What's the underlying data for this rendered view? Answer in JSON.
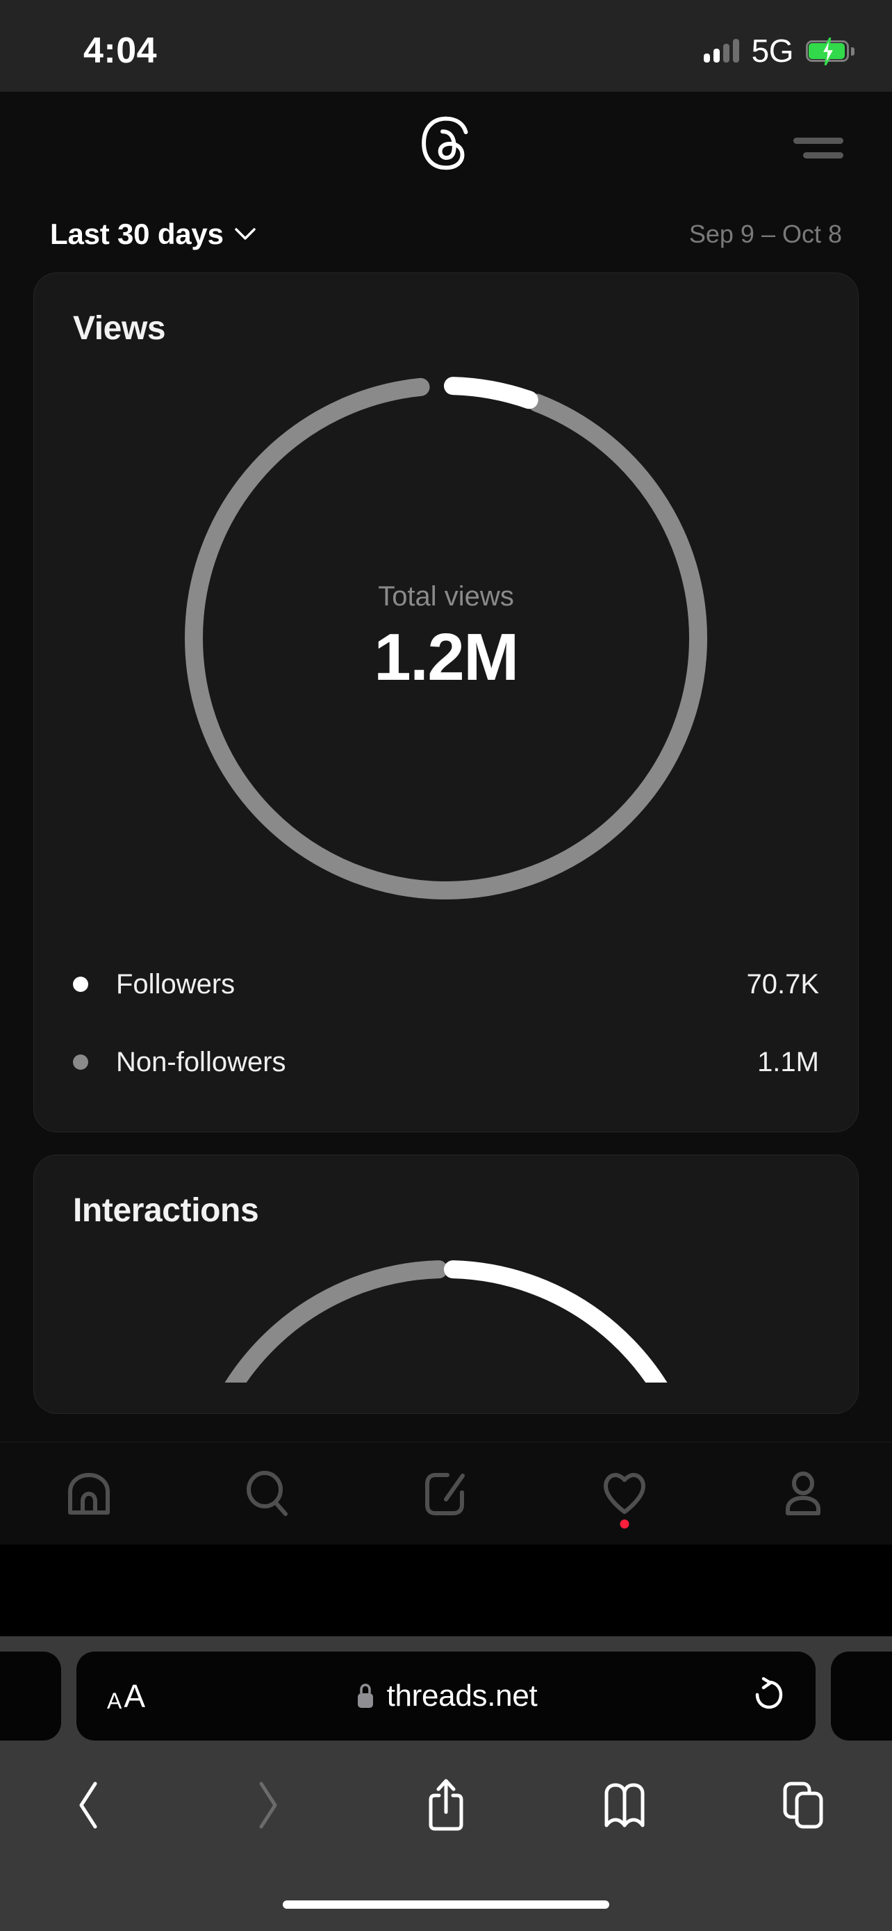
{
  "status_bar": {
    "time": "4:04",
    "network": "5G",
    "signal_icon": "signal-bars-icon",
    "signal_bars_lit": 2,
    "signal_bars_total": 4,
    "battery_icon": "battery-charging-icon",
    "battery_color": "#32d94a"
  },
  "app": {
    "logo_icon": "threads-logo-icon",
    "menu_icon": "hamburger-menu-icon"
  },
  "range": {
    "label": "Last 30 days",
    "chevron_icon": "chevron-down-icon",
    "dates": "Sep 9 – Oct 8"
  },
  "views_card": {
    "title": "Views",
    "center_label": "Total views",
    "center_value": "1.2M",
    "legend": [
      {
        "name": "Followers",
        "value": "70.7K",
        "color": "#ffffff"
      },
      {
        "name": "Non-followers",
        "value": "1.1M",
        "color": "#8a8a8a"
      }
    ]
  },
  "interactions_card": {
    "title": "Interactions"
  },
  "chart_data": [
    {
      "type": "pie",
      "title": "Views",
      "subtitle": "Total views",
      "center_value": "1.2M",
      "total": 1170700,
      "categories": [
        "Followers",
        "Non-followers"
      ],
      "values": [
        70700,
        1100000
      ],
      "display_values": [
        "70.7K",
        "1.1M"
      ],
      "percentages": [
        6.0,
        94.0
      ],
      "colors": [
        "#ffffff",
        "#8a8a8a"
      ],
      "start_angle_deg": 0,
      "donut": true,
      "legend": "bottom",
      "grid": false
    },
    {
      "type": "pie",
      "title": "Interactions",
      "categories": [
        "Followers",
        "Non-followers"
      ],
      "values": [
        25,
        75
      ],
      "percentages": [
        25.0,
        75.0
      ],
      "colors": [
        "#ffffff",
        "#8a8a8a"
      ],
      "start_angle_deg": 0,
      "donut": true,
      "legend": "bottom",
      "grid": false,
      "note": "partially visible - cut off by tab bar"
    }
  ],
  "tabbar": {
    "items": [
      {
        "icon": "home-icon",
        "name": "home"
      },
      {
        "icon": "search-icon",
        "name": "search"
      },
      {
        "icon": "compose-icon",
        "name": "compose"
      },
      {
        "icon": "heart-icon",
        "name": "activity",
        "badge": true
      },
      {
        "icon": "profile-icon",
        "name": "profile"
      }
    ],
    "badge_color": "#ff1f3d"
  },
  "safari": {
    "text_size_label_small": "A",
    "text_size_label_big": "A",
    "lock_icon": "lock-icon",
    "url": "threads.net",
    "reload_icon": "reload-icon",
    "toolbar": [
      {
        "icon": "back-icon",
        "name": "back",
        "enabled": true
      },
      {
        "icon": "forward-icon",
        "name": "forward",
        "enabled": false
      },
      {
        "icon": "share-icon",
        "name": "share",
        "enabled": true
      },
      {
        "icon": "bookmarks-icon",
        "name": "bookmarks",
        "enabled": true
      },
      {
        "icon": "tabs-icon",
        "name": "tabs",
        "enabled": true
      }
    ]
  }
}
